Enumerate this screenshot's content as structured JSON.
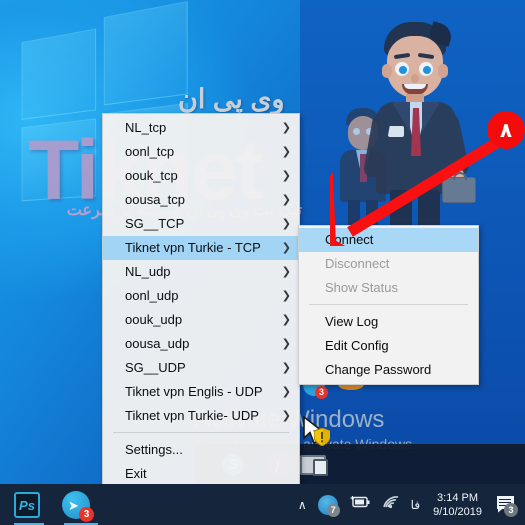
{
  "desktop": {
    "watermark_brand": "Tiknet",
    "watermark_fa_top": "وی پی ان",
    "watermark_fa_sub": "تیک نت وی پی ان همیشه پر سرعت",
    "activate_title": "Activate Windows",
    "activate_subtitle": "Go to Settings to activate Windows.",
    "icons": [
      {
        "name": "skype-icon",
        "label": "S"
      },
      {
        "name": "purple-app-icon",
        "label": "ƒ"
      },
      {
        "name": "remote-desktop-icon",
        "label": ""
      },
      {
        "name": "telegram-desktop-icon",
        "badge": "3"
      },
      {
        "name": "disc-icon",
        "label": ""
      }
    ]
  },
  "annotation": {
    "step_number": "۸",
    "circle_color": "#f40c0c",
    "arrow_color": "#fa1010",
    "arrow_target": "Connect"
  },
  "menu_main": {
    "name": "vpn-tray-context-menu",
    "items": [
      {
        "label": "NL_tcp",
        "submenu": true,
        "selected": false,
        "separator_before": false
      },
      {
        "label": "oonl_tcp",
        "submenu": true,
        "selected": false,
        "separator_before": false
      },
      {
        "label": "oouk_tcp",
        "submenu": true,
        "selected": false,
        "separator_before": false
      },
      {
        "label": "oousa_tcp",
        "submenu": true,
        "selected": false,
        "separator_before": false
      },
      {
        "label": "SG__TCP",
        "submenu": true,
        "selected": false,
        "separator_before": false
      },
      {
        "label": "Tiknet vpn Turkie - TCP",
        "submenu": true,
        "selected": true,
        "separator_before": false
      },
      {
        "label": "NL_udp",
        "submenu": true,
        "selected": false,
        "separator_before": false
      },
      {
        "label": "oonl_udp",
        "submenu": true,
        "selected": false,
        "separator_before": false
      },
      {
        "label": "oouk_udp",
        "submenu": true,
        "selected": false,
        "separator_before": false
      },
      {
        "label": "oousa_udp",
        "submenu": true,
        "selected": false,
        "separator_before": false
      },
      {
        "label": "SG__UDP",
        "submenu": true,
        "selected": false,
        "separator_before": false
      },
      {
        "label": "Tiknet vpn Englis - UDP",
        "submenu": true,
        "selected": false,
        "separator_before": false
      },
      {
        "label": "Tiknet vpn Turkie- UDP",
        "submenu": true,
        "selected": false,
        "separator_before": false
      },
      {
        "label": "Settings...",
        "submenu": false,
        "selected": false,
        "separator_before": true
      },
      {
        "label": "Exit",
        "submenu": false,
        "selected": false,
        "separator_before": false
      }
    ],
    "submenu_arrow": "❯"
  },
  "menu_sub": {
    "name": "vpn-profile-submenu",
    "parent_label": "Tiknet vpn Turkie - TCP",
    "items": [
      {
        "label": "Connect",
        "disabled": false,
        "selected": true,
        "separator_before": false
      },
      {
        "label": "Disconnect",
        "disabled": true,
        "selected": false,
        "separator_before": false
      },
      {
        "label": "Show Status",
        "disabled": true,
        "selected": false,
        "separator_before": false
      },
      {
        "label": "View Log",
        "disabled": false,
        "selected": false,
        "separator_before": true
      },
      {
        "label": "Edit Config",
        "disabled": false,
        "selected": false,
        "separator_before": false
      },
      {
        "label": "Change Password",
        "disabled": false,
        "selected": false,
        "separator_before": false
      }
    ]
  },
  "taskbar": {
    "apps": [
      {
        "name": "photoshop-icon",
        "label": "Ps",
        "badge": ""
      },
      {
        "name": "telegram-icon",
        "label": "",
        "badge": "3"
      }
    ],
    "tray": {
      "overflow_chevron": "∧",
      "updates_badge": "7",
      "language": "فا",
      "time": "3:14 PM",
      "date": "9/10/2019",
      "notification_badge": "3"
    }
  }
}
